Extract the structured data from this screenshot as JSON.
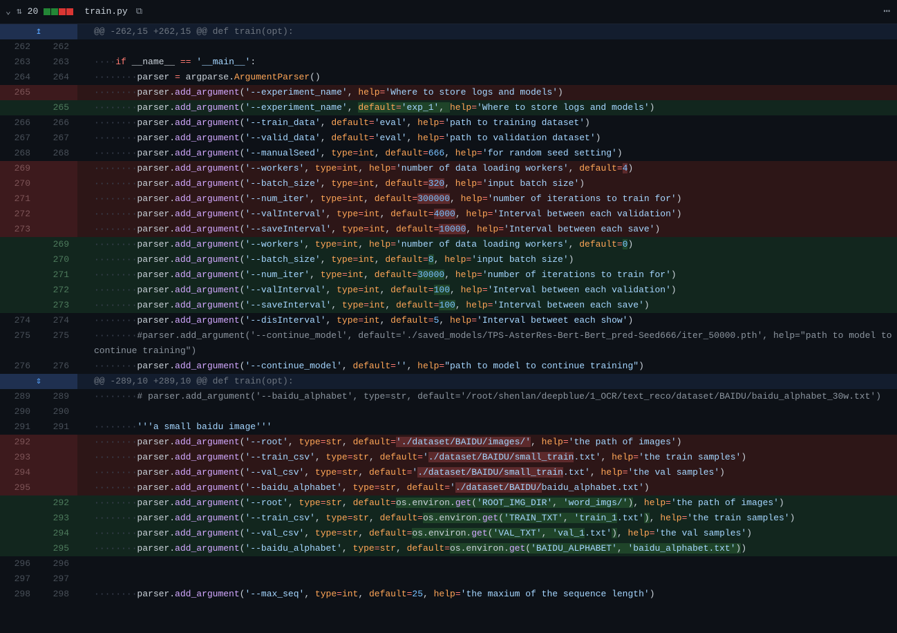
{
  "header": {
    "diff_count": "20",
    "filename": "train.py"
  },
  "hunks": {
    "h1": "@@ -262,15 +262,15 @@ def train(opt):",
    "h2": "@@ -289,10 +289,10 @@ def train(opt):"
  },
  "lines": {
    "l262o": "262",
    "l262n": "262",
    "l263o": "263",
    "l263n": "263",
    "l264o": "264",
    "l264n": "264",
    "l265o": "265",
    "l265n": "265",
    "l266o": "266",
    "l266n": "266",
    "l267o": "267",
    "l267n": "267",
    "l268o": "268",
    "l268n": "268",
    "l269o": "269",
    "l269n": "269",
    "l270o": "270",
    "l270n": "270",
    "l271o": "271",
    "l271n": "271",
    "l272o": "272",
    "l272n": "272",
    "l273o": "273",
    "l273n": "273",
    "l274o": "274",
    "l274n": "274",
    "l275o": "275",
    "l275n": "275",
    "l276o": "276",
    "l276n": "276",
    "l289o": "289",
    "l289n": "289",
    "l290o": "290",
    "l290n": "290",
    "l291o": "291",
    "l291n": "291",
    "l292o": "292",
    "l292n": "292",
    "l293o": "293",
    "l293n": "293",
    "l294o": "294",
    "l294n": "294",
    "l295o": "295",
    "l295n": "295",
    "l296o": "296",
    "l296n": "296",
    "l297o": "297",
    "l297n": "297",
    "l298o": "298",
    "l298n": "298"
  },
  "tokens": {
    "if": "if",
    "name_dunder": "__name__",
    "eq": "==",
    "main_str": "'__main__'",
    "colon": ":",
    "parser": "parser",
    "assign": "=",
    "argparse": "argparse",
    "dot": ".",
    "ArgumentParser": "ArgumentParser",
    "parens": "()",
    "add_argument": "add_argument",
    "lparen": "(",
    "rparen": ")",
    "comma": ", ",
    "help": "help",
    "default": "default",
    "default_eq": "default=",
    "type": "type",
    "int": "int",
    "str_t": "str",
    "os": "os",
    "environ": "environ",
    "get": "get",
    "experiment_name": "'--experiment_name'",
    "exp_help": "'Where to store logs and models'",
    "exp_default": "'exp_1'",
    "train_data": "'--train_data'",
    "eval": "'eval'",
    "train_data_help": "'path to training dataset'",
    "valid_data": "'--valid_data'",
    "valid_data_help": "'path to validation dataset'",
    "manualSeed": "'--manualSeed'",
    "n666": "666",
    "manualSeed_help": "'for random seed setting'",
    "workers": "'--workers'",
    "workers_help": "'number of data loading workers'",
    "n4": "4",
    "n0": "0",
    "batch_size": "'--batch_size'",
    "n320": "320",
    "n8": "8",
    "batch_help": "'input batch size'",
    "num_iter": "'--num_iter'",
    "n300000": "300000",
    "n30000": "30000",
    "num_iter_help": "'number of iterations to train for'",
    "valInterval": "'--valInterval'",
    "n4000": "4000",
    "n100": "100",
    "valInterval_help": "'Interval between each validation'",
    "saveInterval": "'--saveInterval'",
    "n10000": "10000",
    "saveInterval_help": "'Interval between each save'",
    "disInterval": "'--disInterval'",
    "n5": "5",
    "disInterval_help": "'Interval betweet each show'",
    "comment_continue": "#parser.add_argument('--continue_model', default='./saved_models/TPS-AsterRes-Bert-Bert_pred-Seed666/iter_50000.pth', help=\"path to model to continue training\")",
    "continue_model": "'--continue_model'",
    "empty_str": "''",
    "continue_help": "\"path to model to continue training\"",
    "comment_baidu": "# parser.add_argument('--baidu_alphabet', type=str, default='/root/shenlan/deepblue/1_OCR/text_reco/dataset/BAIDU/baidu_alphabet_30w.txt')",
    "small_baidu": "'''a small baidu image'''",
    "root_arg": "'--root'",
    "root_old": "'./dataset/BAIDU/images/'",
    "root_help": "'the path of images'",
    "train_csv": "'--train_csv'",
    "train_csv_old_a": "'",
    "train_csv_old_b": "./dataset/BAIDU/small_train",
    "train_csv_old_c": ".txt'",
    "train_csv_help": "'the train samples'",
    "val_csv": "'--val_csv'",
    "val_csv_old_a": "'",
    "val_csv_old_b": "./dataset/BAIDU/small_train",
    "val_csv_old_c": ".txt'",
    "val_csv_help": "'the val samples'",
    "baidu_alphabet": "'--baidu_alphabet'",
    "baidu_old_a": "'",
    "baidu_old_b": "./dataset/BAIDU/",
    "baidu_old_c": "baidu_alphabet.txt'",
    "ROOT_IMG_DIR": "'ROOT_IMG_DIR'",
    "word_imgs": "'word_imgs/'",
    "TRAIN_TXT": "'TRAIN_TXT'",
    "train_1_a": "'train_1",
    "train_1_b": ".txt'",
    "VAL_TXT": "'VAL_TXT'",
    "val_1_a": "'val_1",
    "val_1_b": ".txt'",
    "BAIDU_ALPHABET": "'BAIDU_ALPHABET'",
    "baidu_txt": "'baidu_alphabet.txt'",
    "max_seq": "'--max_seq'",
    "n25": "25",
    "max_seq_help": "'the maxium of the sequence length'",
    "ws4": "····",
    "ws8": "········",
    "sp": " "
  }
}
